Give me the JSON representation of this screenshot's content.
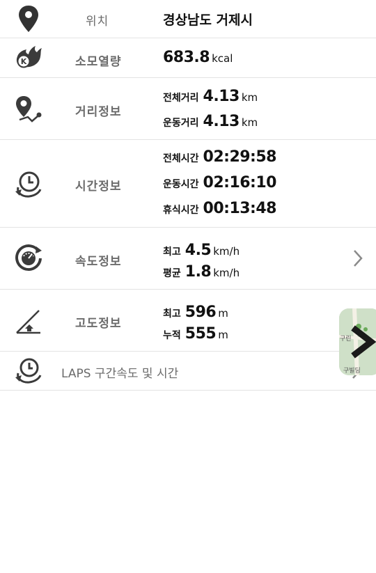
{
  "location": {
    "label": "위치",
    "value": "경상남도 거제시"
  },
  "calories": {
    "label": "소모열량",
    "value": "683.8",
    "unit": "kcal"
  },
  "distance": {
    "label": "거리정보",
    "items": [
      {
        "name": "전체거리",
        "value": "4.13",
        "unit": "km"
      },
      {
        "name": "운동거리",
        "value": "4.13",
        "unit": "km"
      }
    ]
  },
  "time": {
    "label": "시간정보",
    "items": [
      {
        "name": "전체시간",
        "value": "02:29:58"
      },
      {
        "name": "운동시간",
        "value": "02:16:10"
      },
      {
        "name": "휴식시간",
        "value": "00:13:48"
      }
    ]
  },
  "speed": {
    "label": "속도정보",
    "items": [
      {
        "name": "최고",
        "value": "4.5",
        "unit": "km/h"
      },
      {
        "name": "평균",
        "value": "1.8",
        "unit": "km/h"
      }
    ]
  },
  "altitude": {
    "label": "고도정보",
    "items": [
      {
        "name": "최고",
        "value": "596",
        "unit": "m"
      },
      {
        "name": "누적",
        "value": "555",
        "unit": "m"
      }
    ]
  },
  "laps": {
    "label": "LAPS 구간속도 및 시간"
  },
  "map_overlay": {
    "text_top": "구린",
    "text_bottom": "구빌딩"
  },
  "colors": {
    "icon": "#3b3b3b",
    "label": "#6b6b6b",
    "divider": "#e3e3e3",
    "chevron": "#8a8a8a"
  }
}
